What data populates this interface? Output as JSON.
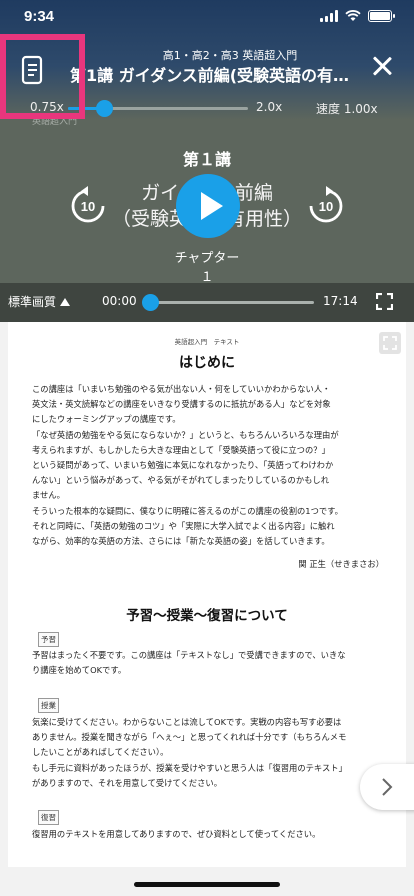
{
  "status_bar": {
    "time": "9:34"
  },
  "header": {
    "subtitle": "高1・高2・高3 英語超入門",
    "title": "第1講 ガイダンス前編(受験英語の有…",
    "toc_icon": "document-list-icon",
    "close_icon": "close-icon"
  },
  "speed": {
    "min_label": "0.75x",
    "max_label": "2.0x",
    "current_label": "速度 1.00x",
    "value_fraction": 0.2,
    "ghost_text": "英語超入門"
  },
  "video": {
    "lesson_number": "第１講",
    "title_line1": "ガイダンス前編",
    "title_line2": "（受験英語の有用性）",
    "chapter": "チャプター　１",
    "rewind_seconds": "10",
    "forward_seconds": "10"
  },
  "controls": {
    "quality": "標準画質",
    "current_time": "00:00",
    "total_time": "17:14",
    "progress_fraction": 0.0
  },
  "document": {
    "header_small": "英語超入門　テキスト",
    "title": "はじめに",
    "intro_lines": [
      "この講座は「いまいち勉強のやる気が出ない人・何をしていいかわからない人・",
      "英文法・英文読解などの講座をいきなり受講するのに抵抗がある人」などを対象",
      "にしたウォーミングアップの講座です。",
      "「なぜ英語の勉強をやる気にならないか？」というと、もちろんいろいろな理由が",
      "考えられますが、もしかしたら大きな理由として「受験英語って役に立つの？」",
      "という疑問があって、いまいち勉強に本気になれなかったり、「英語ってわけわか",
      "んない」という悩みがあって、やる気がそがれてしまったりしているのかもしれ",
      "ません。",
      "そういった根本的な疑問に、僕なりに明確に答えるのがこの講座の役割の1つです。",
      "それと同時に、「英語の勉強のコツ」や「実際に大学入試でよく出る内容」に触れ",
      "ながら、効率的な英語の方法、さらには「新たな英語の姿」を話していきます。"
    ],
    "signature": "関 正生（せきまさお）",
    "section_title": "予習〜授業〜復習について",
    "tag_prep": "予習",
    "prep_text": "予習はまったく不要です。この講座は「テキストなし」で受講できますので、いきな",
    "prep_text2": "り講座を始めてOKです。",
    "tag_class": "授業",
    "class_lines": [
      "気楽に受けてください。わからないことは流してOKです。実戦の内容も写す必要は",
      "ありません。授業を聞きながら「へぇ〜」と思ってくれれば十分です（もちろんメモ",
      "したいことがあればしてください）。",
      "もし手元に資料があったほうが、授業を受けやすいと思う人は「復習用のテキスト」",
      "がありますので、それを用意して受けてください。"
    ],
    "tag_review": "復習",
    "review_text": "復習用のテキストを用意してありますので、ぜひ資料として使ってください。"
  },
  "icons": {
    "expand": "expand-icon",
    "next": "chevron-right-icon",
    "fullscreen": "fullscreen-icon",
    "rewind": "rewind-10-icon",
    "forward": "forward-10-icon",
    "play": "play-icon"
  },
  "colors": {
    "accent": "#1aa0e8",
    "highlight": "#e9367d"
  }
}
